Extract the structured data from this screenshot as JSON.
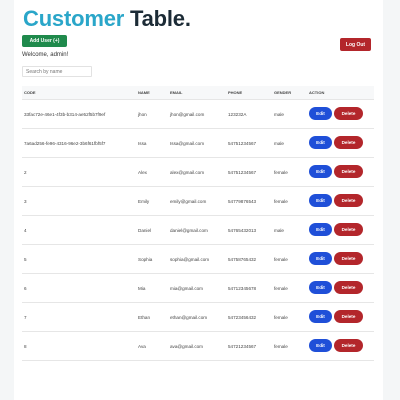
{
  "header": {
    "title_part1": "Customer",
    "title_part2": "Table.",
    "add_user_label": "Add User (+)",
    "logout_label": "Log Out",
    "welcome_text": "Welcome, admin!"
  },
  "search": {
    "placeholder": "Search by name",
    "value": ""
  },
  "table": {
    "columns": [
      "Code",
      "Name",
      "Email",
      "Phone",
      "Gender",
      "Action"
    ],
    "rows": [
      {
        "code": "33fac72e-46e1-4f3b-b314-ae52f5b7f9ef",
        "name": "jhon",
        "email": "jhon@gmail.com",
        "phone": "123232A",
        "gender": "male"
      },
      {
        "code": "7a6ad256-fe96-4316-96e2-3b6f61fbf5f7",
        "name": "Issa",
        "email": "Issa@gmail.com",
        "phone": "54751234567",
        "gender": "male"
      },
      {
        "code": "2",
        "name": "Alex",
        "email": "alex@gmail.com",
        "phone": "54751234567",
        "gender": "female"
      },
      {
        "code": "3",
        "name": "Emily",
        "email": "emily@gmail.com",
        "phone": "54779876543",
        "gender": "female"
      },
      {
        "code": "4",
        "name": "Daniel",
        "email": "daniel@gmail.com",
        "phone": "54765432013",
        "gender": "male"
      },
      {
        "code": "5",
        "name": "Sophia",
        "email": "sophia@gmail.com",
        "phone": "54758765432",
        "gender": "female"
      },
      {
        "code": "6",
        "name": "Mia",
        "email": "mia@gmail.com",
        "phone": "54712345678",
        "gender": "female"
      },
      {
        "code": "7",
        "name": "Ethan",
        "email": "ethan@gmail.com",
        "phone": "54723456432",
        "gender": "female"
      },
      {
        "code": "8",
        "name": "Ava",
        "email": "ava@gmail.com",
        "phone": "54721234567",
        "gender": "female"
      }
    ],
    "edit_label": "Edit",
    "delete_label": "Delete"
  },
  "colors": {
    "title_accent": "#2aa6c9",
    "title_dark": "#1c2b36",
    "add_button": "#1f8a4c",
    "logout_button": "#b3262b",
    "edit_button": "#1f4fd8",
    "delete_button": "#b3262b"
  }
}
